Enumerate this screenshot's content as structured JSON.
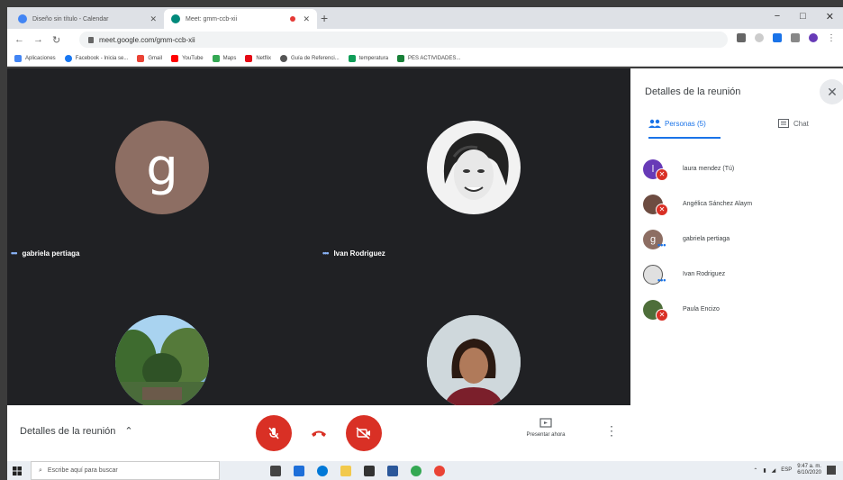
{
  "browser": {
    "tabs": [
      {
        "label": "Diseño sin título - Calendar"
      },
      {
        "label": "Meet: gmm-ccb-xii"
      }
    ],
    "new_tab_icon": "+",
    "window_controls": {
      "minimize": "−",
      "restore": "□",
      "close": "✕"
    },
    "url": "meet.google.com/gmm-ccb-xii",
    "bookmarks": [
      {
        "label": "Aplicaciones",
        "color": "#4285f4"
      },
      {
        "label": "Facebook - Inicia se...",
        "color": "#1877f2"
      },
      {
        "label": "Gmail",
        "color": "#ea4335"
      },
      {
        "label": "YouTube",
        "color": "#ff0000"
      },
      {
        "label": "Maps",
        "color": "#34a853"
      },
      {
        "label": "Netflix",
        "color": "#e50914"
      },
      {
        "label": "Guía de Referenci...",
        "color": "#555555"
      },
      {
        "label": "temperatura",
        "color": "#0f9d58"
      },
      {
        "label": "PES ACTIVIDADES...",
        "color": "#188038"
      }
    ]
  },
  "stage": {
    "tiles": [
      {
        "name": "gabriela pertiaga",
        "initial": "g",
        "avatar_color": "#8d6e63"
      },
      {
        "name": "Ivan Rodriguez"
      },
      {
        "name": ""
      },
      {
        "name": ""
      }
    ]
  },
  "panel": {
    "title": "Detalles de la reunión",
    "close_icon": "✕",
    "tab_people": "Personas (5)",
    "tab_chat": "Chat",
    "people": [
      {
        "name": "laura mendez (Tú)",
        "initial": "l",
        "color": "#673ab7",
        "status": "muted"
      },
      {
        "name": "Angélica Sánchez Alaym",
        "initial": "",
        "color": "#6d4c41",
        "status": "muted"
      },
      {
        "name": "gabriela pertiaga",
        "initial": "g",
        "color": "#8d6e63",
        "status": "speaking"
      },
      {
        "name": "Ivan Rodriguez",
        "initial": "",
        "color": "#e0e0e0",
        "status": "speaking"
      },
      {
        "name": "Paula Encizo",
        "initial": "",
        "color": "#4e6e3a",
        "status": "muted"
      }
    ]
  },
  "meetbar": {
    "details_label": "Detalles de la reunión",
    "present_label": "Presentar ahora",
    "more_icon": "⋮"
  },
  "taskbar": {
    "search_placeholder": "Escribe aquí para buscar",
    "language": "ESP",
    "time": "9:47 a. m.",
    "date": "6/10/2020"
  }
}
